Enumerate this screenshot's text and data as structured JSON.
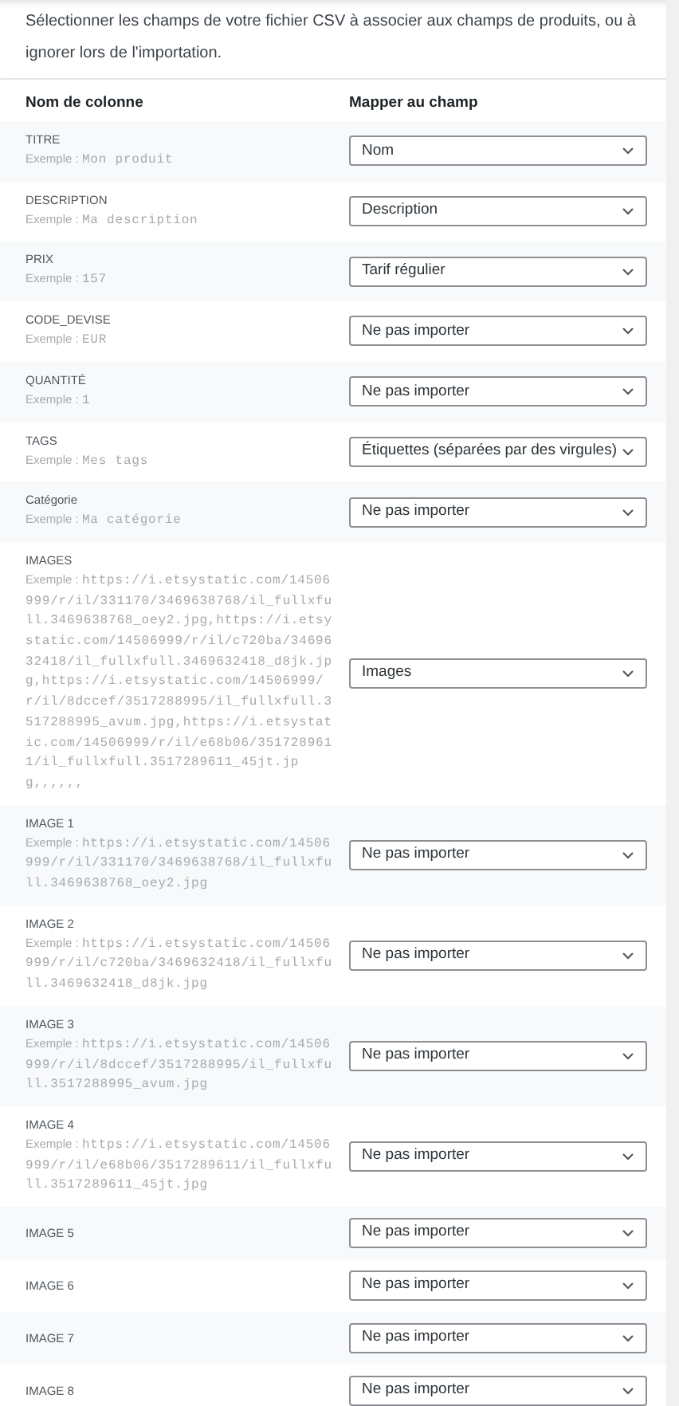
{
  "intro": "Sélectionner les champs de votre fichier CSV à associer aux champs de produits, ou à ignorer lors de l'importation.",
  "columns": [
    "Nom de colonne",
    "Mapper au champ"
  ],
  "rows": [
    {
      "name": "TITRE",
      "example_label": "Exemple :",
      "example": "Mon produit",
      "value": "Nom"
    },
    {
      "name": "DESCRIPTION",
      "example_label": "Exemple :",
      "example": "Ma description",
      "value": "Description"
    },
    {
      "name": "PRIX",
      "example_label": "Exemple :",
      "example": "157",
      "value": "Tarif régulier"
    },
    {
      "name": "CODE_DEVISE",
      "example_label": "Exemple :",
      "example": "EUR",
      "value": "Ne pas importer"
    },
    {
      "name": "QUANTITÉ",
      "example_label": "Exemple :",
      "example": "1",
      "value": "Ne pas importer"
    },
    {
      "name": "TAGS",
      "example_label": "Exemple :",
      "example": "Mes tags",
      "value": "Étiquettes (séparées par des virgules)"
    },
    {
      "name": "Catégorie",
      "example_label": "Exemple :",
      "example": "Ma catégorie",
      "value": "Ne pas importer"
    },
    {
      "name": "IMAGES",
      "example_label": "Exemple :",
      "example": "https://i.etsystatic.com/14506999/r/il/331170/3469638768/il_fullxfull.3469638768_oey2.jpg,https://i.etsystatic.com/14506999/r/il/c720ba/3469632418/il_fullxfull.3469632418_d8jk.jpg,https://i.etsystatic.com/14506999/r/il/8dccef/3517288995/il_fullxfull.3517288995_avum.jpg,https://i.etsystatic.com/14506999/r/il/e68b06/3517289611/il_fullxfull.3517289611_45jt.jpg,,,,,,",
      "value": "Images"
    },
    {
      "name": "IMAGE 1",
      "example_label": "Exemple :",
      "example": "https://i.etsystatic.com/14506999/r/il/331170/3469638768/il_fullxfull.3469638768_oey2.jpg",
      "value": "Ne pas importer"
    },
    {
      "name": "IMAGE 2",
      "example_label": "Exemple :",
      "example": "https://i.etsystatic.com/14506999/r/il/c720ba/3469632418/il_fullxfull.3469632418_d8jk.jpg",
      "value": "Ne pas importer"
    },
    {
      "name": "IMAGE 3",
      "example_label": "Exemple :",
      "example": "https://i.etsystatic.com/14506999/r/il/8dccef/3517288995/il_fullxfull.3517288995_avum.jpg",
      "value": "Ne pas importer"
    },
    {
      "name": "IMAGE 4",
      "example_label": "Exemple :",
      "example": "https://i.etsystatic.com/14506999/r/il/e68b06/3517289611/il_fullxfull.3517289611_45jt.jpg",
      "value": "Ne pas importer"
    },
    {
      "name": "IMAGE 5",
      "value": "Ne pas importer"
    },
    {
      "name": "IMAGE 6",
      "value": "Ne pas importer"
    },
    {
      "name": "IMAGE 7",
      "value": "Ne pas importer"
    },
    {
      "name": "IMAGE 8",
      "value": "Ne pas importer"
    }
  ]
}
